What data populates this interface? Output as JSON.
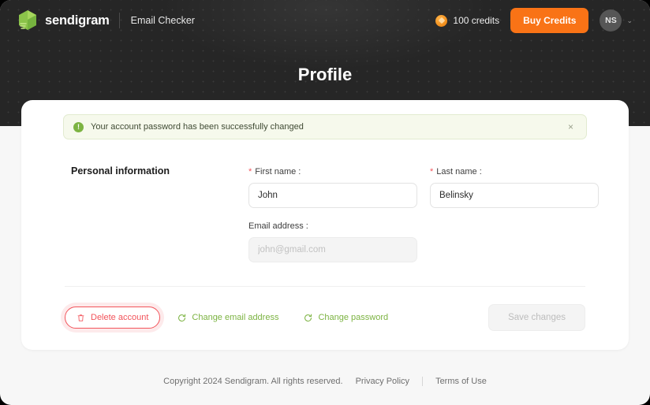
{
  "topbar": {
    "brand_name": "sendigram",
    "app_name": "Email Checker",
    "credits_label": "100 credits",
    "buy_credits_label": "Buy Credits",
    "avatar_initials": "NS",
    "chevron": "⌄"
  },
  "hero": {
    "page_title": "Profile"
  },
  "alert": {
    "icon_glyph": "!",
    "message": "Your account password has been successfully changed",
    "close_glyph": "×"
  },
  "form": {
    "section_title": "Personal information",
    "first_name": {
      "label": "First name :",
      "required_mark": "*",
      "value": "John",
      "placeholder": ""
    },
    "last_name": {
      "label": "Last name :",
      "required_mark": "*",
      "value": "Belinsky",
      "placeholder": ""
    },
    "email": {
      "label": "Email address :",
      "value": "",
      "placeholder": "john@gmail.com"
    }
  },
  "actions": {
    "delete_account": "Delete account",
    "change_email": "Change email address",
    "change_password": "Change password",
    "save_changes": "Save changes"
  },
  "footer": {
    "copyright": "Copyright 2024 Sendigram. All rights reserved.",
    "privacy_policy": "Privacy Policy",
    "terms_of_use": "Terms of Use"
  },
  "colors": {
    "hero_bg": "#262626",
    "accent_green": "#7cb342",
    "accent_orange": "#f97316",
    "danger_red": "#f2545b",
    "alert_bg": "#f6f9ec"
  }
}
